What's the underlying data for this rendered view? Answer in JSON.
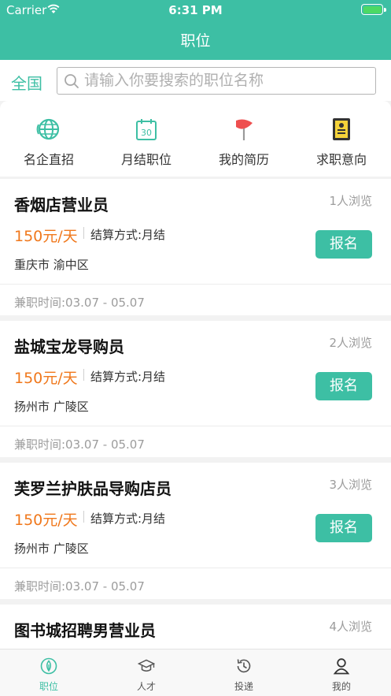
{
  "status_bar": {
    "carrier": "Carrier",
    "time": "6:31 PM"
  },
  "nav": {
    "title": "职位"
  },
  "search": {
    "city": "全国",
    "placeholder": "请输入你要搜索的职位名称"
  },
  "categories": [
    {
      "label": "名企直招",
      "icon": "globe-icon"
    },
    {
      "label": "月结职位",
      "icon": "calendar-icon"
    },
    {
      "label": "我的简历",
      "icon": "flag-icon"
    },
    {
      "label": "求职意向",
      "icon": "resume-card-icon"
    }
  ],
  "jobs": [
    {
      "title": "香烟店营业员",
      "views": "1人浏览",
      "wage": "150元/天",
      "settlement": "结算方式:月结",
      "location": "重庆市 渝中区",
      "button": "报名",
      "period": "兼职时间:03.07 - 05.07"
    },
    {
      "title": "盐城宝龙导购员",
      "views": "2人浏览",
      "wage": "150元/天",
      "settlement": "结算方式:月结",
      "location": "扬州市 广陵区",
      "button": "报名",
      "period": "兼职时间:03.07 - 05.07"
    },
    {
      "title": "芙罗兰护肤品导购店员",
      "views": "3人浏览",
      "wage": "150元/天",
      "settlement": "结算方式:月结",
      "location": "扬州市 广陵区",
      "button": "报名",
      "period": "兼职时间:03.07 - 05.07"
    },
    {
      "title": "图书城招聘男营业员",
      "views": "4人浏览"
    }
  ],
  "tabs": [
    {
      "label": "职位",
      "icon": "drop-icon",
      "active": true
    },
    {
      "label": "人才",
      "icon": "graduation-cap-icon",
      "active": false
    },
    {
      "label": "投递",
      "icon": "history-icon",
      "active": false
    },
    {
      "label": "我的",
      "icon": "person-icon",
      "active": false
    }
  ],
  "colors": {
    "accent": "#3dbfa4",
    "wage": "#f0781c",
    "flag": "#ee4f4f",
    "resume": "#f5d33a"
  }
}
